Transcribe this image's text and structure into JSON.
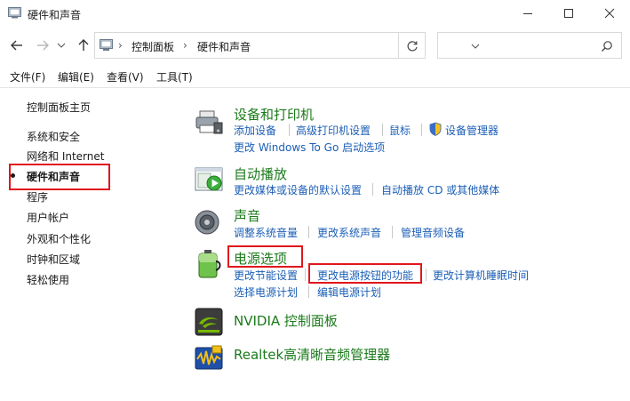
{
  "window": {
    "title": "硬件和声音"
  },
  "address": {
    "crumbs": [
      "控制面板",
      "硬件和声音"
    ],
    "search_placeholder": ""
  },
  "menu": [
    "文件(F)",
    "编辑(E)",
    "查看(V)",
    "工具(T)"
  ],
  "sidebar": {
    "items": [
      "控制面板主页",
      "系统和安全",
      "网络和 Internet",
      "硬件和声音",
      "程序",
      "用户帐户",
      "外观和个性化",
      "时钟和区域",
      "轻松使用"
    ],
    "active": "硬件和声音"
  },
  "categories": {
    "devices": {
      "title": "设备和打印机",
      "links": [
        "添加设备",
        "高级打印机设置",
        "鼠标",
        "设备管理器",
        "更改 Windows To Go 启动选项"
      ]
    },
    "autoplay": {
      "title": "自动播放",
      "links": [
        "更改媒体或设备的默认设置",
        "自动播放 CD 或其他媒体"
      ]
    },
    "sound": {
      "title": "声音",
      "links": [
        "调整系统音量",
        "更改系统声音",
        "管理音频设备"
      ]
    },
    "power": {
      "title": "电源选项",
      "links": [
        "更改节能设置",
        "更改电源按钮的功能",
        "更改计算机睡眠时间",
        "选择电源计划",
        "编辑电源计划"
      ]
    },
    "nvidia": {
      "title": "NVIDIA 控制面板"
    },
    "realtek": {
      "title": "Realtek高清晰音频管理器"
    }
  },
  "colors": {
    "category_title": "#1b7a1b",
    "link": "#1c5fb6",
    "highlight": "#e0161d"
  }
}
